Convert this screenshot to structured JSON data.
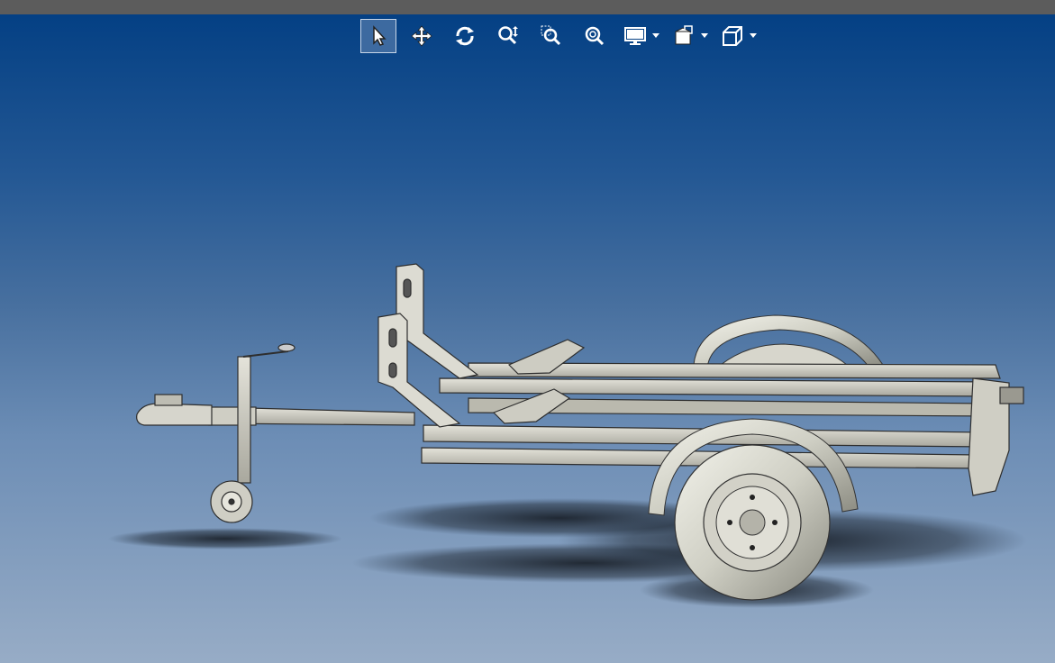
{
  "window": {
    "topbar_color": "#5c5c5c"
  },
  "viewport": {
    "background_top": "#044084",
    "background_bottom": "#97acc6",
    "model": "trailer-assembly"
  },
  "toolbar": {
    "buttons": [
      {
        "id": "select",
        "icon": "cursor-arrow-icon",
        "active": true
      },
      {
        "id": "pan",
        "icon": "move-arrows-icon",
        "active": false
      },
      {
        "id": "rotate",
        "icon": "rotate-icon",
        "active": false
      },
      {
        "id": "zoom-in-out",
        "icon": "zoom-in-out-icon",
        "active": false
      },
      {
        "id": "zoom-to-area",
        "icon": "zoom-area-icon",
        "active": false
      },
      {
        "id": "zoom-to-fit",
        "icon": "zoom-fit-icon",
        "active": false
      },
      {
        "id": "display-style",
        "icon": "monitor-icon",
        "dropdown": true
      },
      {
        "id": "section-view",
        "icon": "section-view-icon",
        "dropdown": true
      },
      {
        "id": "view-orientation",
        "icon": "cube-icon",
        "dropdown": true
      }
    ]
  }
}
